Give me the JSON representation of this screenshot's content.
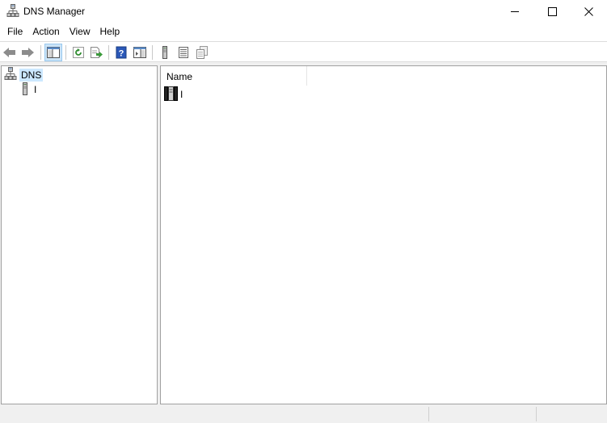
{
  "window": {
    "title": "DNS Manager",
    "icon": "dns-tree-icon"
  },
  "menu": {
    "items": [
      {
        "label": "File"
      },
      {
        "label": "Action"
      },
      {
        "label": "View"
      },
      {
        "label": "Help"
      }
    ]
  },
  "toolbar": {
    "buttons": [
      {
        "icon": "back-arrow-icon"
      },
      {
        "icon": "forward-arrow-icon"
      },
      {
        "icon": "show-hide-console-tree-icon",
        "active": true
      },
      {
        "icon": "refresh-icon"
      },
      {
        "icon": "export-list-icon"
      },
      {
        "icon": "help-icon"
      },
      {
        "icon": "show-hide-action-pane-icon"
      },
      {
        "icon": "server-icon"
      },
      {
        "icon": "list-view-icon"
      },
      {
        "icon": "properties-icon"
      }
    ]
  },
  "tree": {
    "root_label": "DNS",
    "child_label": "I"
  },
  "list": {
    "column_name": "Name",
    "rows": [
      {
        "label": "I"
      }
    ]
  },
  "colors": {
    "selection_bg": "#cce8ff",
    "toolbar_active_bg": "#cce4f7",
    "pane_border": "#a0a0a0",
    "background": "#f0f0f0"
  }
}
